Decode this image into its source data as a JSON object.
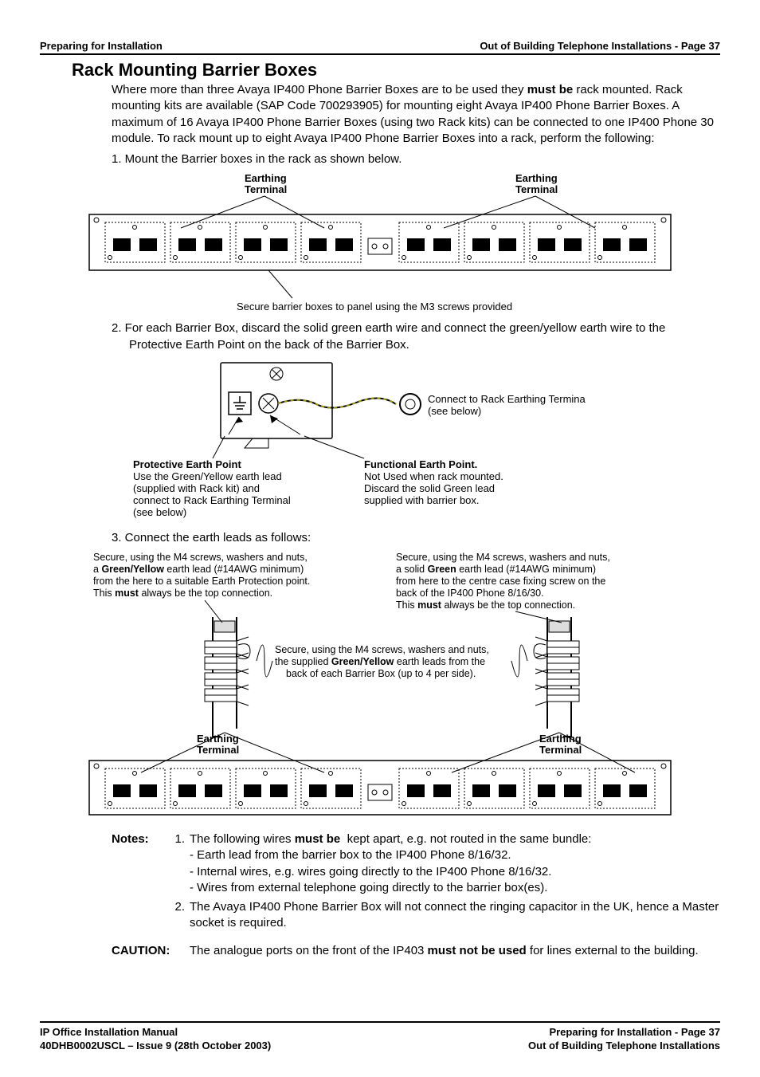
{
  "header": {
    "left": "Preparing for Installation",
    "right": "Out of Building Telephone Installations - Page 37"
  },
  "section_title": "Rack Mounting Barrier Boxes",
  "intro_html": "Where more than three Avaya IP400 Phone Barrier Boxes are to be used they <b>must be</b> rack mounted. Rack mounting kits are available (SAP Code 700293905) for mounting eight Avaya IP400 Phone Barrier Boxes. A maximum of 16 Avaya IP400 Phone Barrier Boxes (using two Rack kits) can be connected to one IP400 Phone 30 module. To rack mount up to eight Avaya IP400 Phone Barrier Boxes into a rack, perform the following:",
  "step1": "1.  Mount the Barrier boxes in the rack as shown below.",
  "step2": "2.  For each Barrier Box, discard the solid green earth wire and connect the green/yellow earth wire to the Protective Earth Point on the back of the Barrier Box.",
  "step3": "3.  Connect the earth leads as follows:",
  "fig1": {
    "earthing_terminal": "Earthing",
    "earthing_terminal2": "Terminal",
    "caption": "Secure barrier boxes to panel using the M3 screws provided"
  },
  "fig2": {
    "connect_rack1": "Connect to Rack Earthing Termina",
    "connect_rack2": "(see below)",
    "prot_title": "Protective Earth Point",
    "prot_l1": "Use the Green/Yellow earth lead",
    "prot_l2": "(supplied with Rack kit) and",
    "prot_l3": "connect to Rack Earthing Terminal",
    "prot_l4": "(see below)",
    "func_title": "Functional Earth Point.",
    "func_l1": "Not Used when rack mounted.",
    "func_l2": "Discard the solid Green lead",
    "func_l3": "supplied with barrier box."
  },
  "fig3": {
    "left_l1": "Secure, using the M4 screws, washers and nuts,",
    "left_l2_a": "a ",
    "left_l2_b": "Green/Yellow",
    "left_l2_c": " earth lead (#14AWG minimum)",
    "left_l3": "from the here to a suitable Earth Protection point.",
    "left_l4_a": "This ",
    "left_l4_b": "must",
    "left_l4_c": " always be the top connection.",
    "right_l1": "Secure, using the M4 screws, washers and nuts,",
    "right_l2_a": "a solid ",
    "right_l2_b": "Green",
    "right_l2_c": " earth lead (#14AWG minimum)",
    "right_l3": "from here to the centre case fixing screw on the",
    "right_l4": "back of the IP400 Phone 8/16/30.",
    "right_l5_a": "This ",
    "right_l5_b": "must",
    "right_l5_c": " always be the top connection.",
    "mid_l1": "Secure, using the M4 screws, washers and nuts,",
    "mid_l2_a": "the supplied ",
    "mid_l2_b": "Green/Yellow",
    "mid_l2_c": " earth leads from the",
    "mid_l3": "back of each Barrier Box (up to 4 per side).",
    "earthing_terminal": "Earthing",
    "earthing_terminal2": "Terminal"
  },
  "notes": {
    "label": "Notes:",
    "n1_html": "The following wires <b>must be</b>&nbsp; kept apart, e.g. not routed in the same bundle:",
    "n1a": "- Earth lead from the barrier box to the IP400 Phone 8/16/32.",
    "n1b": "- Internal wires, e.g. wires going directly to the IP400 Phone 8/16/32.",
    "n1c": "- Wires from external telephone going directly to the barrier box(es).",
    "n2": "The Avaya IP400 Phone Barrier Box will not connect the ringing capacitor in the UK, hence a Master socket is required."
  },
  "caution": {
    "label": "CAUTION:",
    "text_html": "The analogue ports on the front of the IP403 <b>must not be used</b> for lines external to the building."
  },
  "footer": {
    "left1": "IP Office Installation Manual",
    "left2": "40DHB0002USCL – Issue 9 (28th October 2003)",
    "right1": "Preparing for Installation - Page 37",
    "right2": "Out of Building Telephone Installations"
  }
}
